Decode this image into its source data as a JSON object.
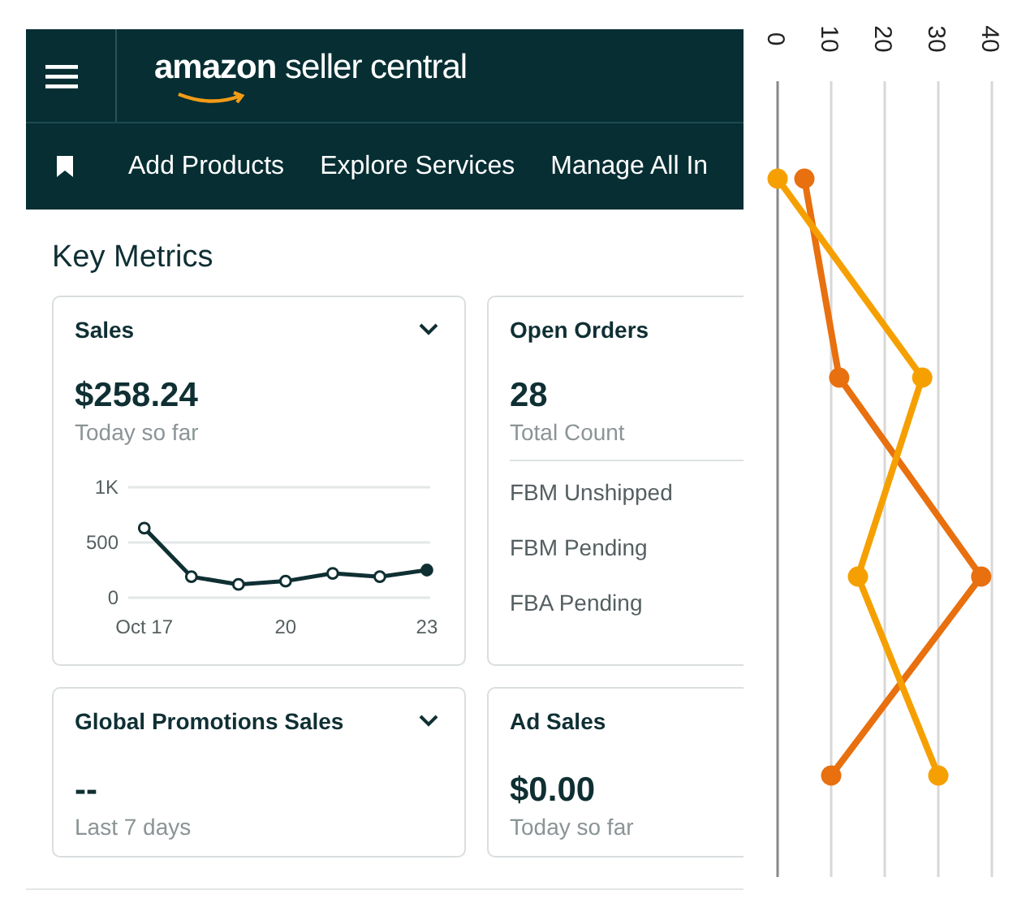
{
  "header": {
    "logo": "**amazon** seller central"
  },
  "nav": {
    "links": [
      "Add Products",
      "Explore Services",
      "Manage All In"
    ]
  },
  "section_title": "Key Metrics",
  "cards": [
    {
      "kind": "chart",
      "title": "Sales",
      "dropdown": true,
      "value": "$258.24",
      "caption": "Today so far",
      "chart_data": {
        "type": "line",
        "grid": true,
        "x": [
          17,
          18,
          19,
          20,
          21,
          22,
          23
        ],
        "series": [
          {
            "color": "#0f2f33",
            "marker": "circle",
            "values": [
              630,
              190,
              120,
              150,
              220,
              190,
              250
            ]
          }
        ],
        "xlim": [
          16.66,
          23.07
        ],
        "ylim": [
          0,
          1000
        ],
        "yticks": [
          0,
          500,
          {
            "value": 1000,
            "label": "1K"
          }
        ],
        "xticks": [
          {
            "value": 17,
            "label": "Oct 17"
          },
          20,
          23
        ]
      }
    },
    {
      "kind": "list",
      "title": "Open Orders",
      "dropdown": false,
      "value": "28",
      "caption": "Total Count",
      "rows": [
        "FBM Unshipped",
        "FBM Pending",
        "FBA Pending"
      ]
    },
    {
      "kind": "plain",
      "title": "Global Promotions Sales",
      "dropdown": true,
      "value": "--",
      "caption": "Last 7 days"
    },
    {
      "kind": "plain",
      "title": "Ad Sales",
      "dropdown": false,
      "value": "$0.00",
      "caption": "Today so far"
    }
  ],
  "side_chart": {
    "chart_data": {
      "type": "line",
      "orientation": "horizontal",
      "grid": true,
      "xlim": [
        0,
        40
      ],
      "xticks": [
        0,
        10,
        20,
        30,
        40
      ],
      "series": [
        {
          "color": "#e8700f",
          "marker": "circle",
          "values": [
            5,
            11.5,
            38,
            10
          ]
        },
        {
          "color": "#f5a000",
          "marker": "circle",
          "values": [
            0,
            27,
            15,
            30
          ]
        }
      ]
    }
  }
}
